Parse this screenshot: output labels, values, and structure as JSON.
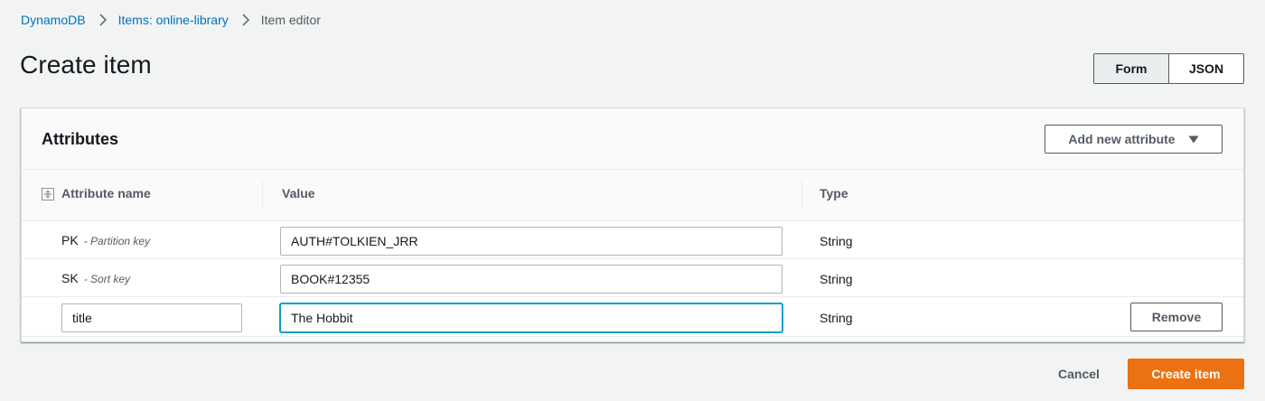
{
  "breadcrumb": {
    "items": [
      {
        "label": "DynamoDB"
      },
      {
        "label": "Items: online-library"
      },
      {
        "label": "Item editor"
      }
    ]
  },
  "page": {
    "title": "Create item"
  },
  "view_toggle": {
    "form_label": "Form",
    "json_label": "JSON",
    "selected": "Form"
  },
  "panel": {
    "title": "Attributes",
    "add_button_label": "Add new attribute",
    "columns": {
      "name": "Attribute name",
      "value": "Value",
      "type": "Type"
    },
    "rows": [
      {
        "name": "PK",
        "note": "- Partition key",
        "value": "AUTH#TOLKIEN_JRR",
        "type": "String"
      },
      {
        "name": "SK",
        "note": "- Sort key",
        "value": "BOOK#12355",
        "type": "String"
      },
      {
        "name": "title",
        "value": "The Hobbit",
        "type": "String",
        "remove_label": "Remove"
      }
    ]
  },
  "footer": {
    "cancel_label": "Cancel",
    "create_label": "Create item"
  },
  "colors": {
    "link": "#0073bb",
    "primary": "#ec7211",
    "focus": "#00a1c9",
    "background": "#f2f3f3"
  }
}
